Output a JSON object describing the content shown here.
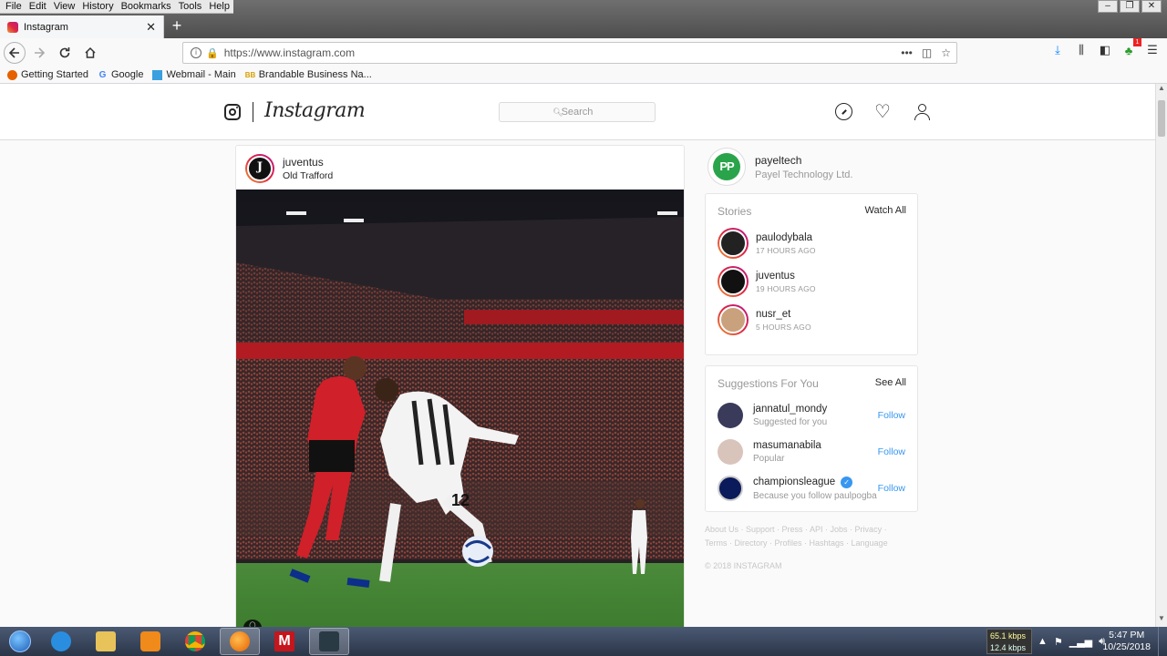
{
  "browser": {
    "menu": [
      "File",
      "Edit",
      "View",
      "History",
      "Bookmarks",
      "Tools",
      "Help"
    ],
    "tab_title": "Instagram",
    "tab_close": "✕",
    "new_tab": "+",
    "url": "https://www.instagram.com",
    "bookmarks": [
      "Getting Started",
      "Google",
      "Webmail - Main",
      "Brandable Business Na..."
    ],
    "window_controls": [
      "–",
      "❐",
      "✕"
    ]
  },
  "instagram": {
    "wordmark": "Instagram",
    "search_placeholder": "Search",
    "post": {
      "username": "juventus",
      "location": "Old Trafford",
      "player_number": "12"
    },
    "profile": {
      "username": "payeltech",
      "full_name": "Payel Technology Ltd.",
      "avatar_initials": "PP"
    },
    "stories": {
      "title": "Stories",
      "action": "Watch All",
      "items": [
        {
          "username": "paulodybala",
          "time": "17 HOURS AGO"
        },
        {
          "username": "juventus",
          "time": "19 HOURS AGO"
        },
        {
          "username": "nusr_et",
          "time": "5 HOURS AGO"
        }
      ]
    },
    "suggestions": {
      "title": "Suggestions For You",
      "action": "See All",
      "items": [
        {
          "username": "jannatul_mondy",
          "subtitle": "Suggested for you",
          "action": "Follow"
        },
        {
          "username": "masumanabila",
          "subtitle": "Popular",
          "action": "Follow"
        },
        {
          "username": "championsleague",
          "subtitle": "Because you follow paulpogba",
          "action": "Follow"
        }
      ]
    },
    "footer": {
      "links_line1": "About Us · Support · Press · API · Jobs · Privacy ·",
      "links_line2": "Terms · Directory · Profiles · Hashtags · Language",
      "copyright": "© 2018 INSTAGRAM"
    }
  },
  "taskbar": {
    "net_down": "65.1 kbps",
    "net_up": "12.4 kbps",
    "time": "5:47 PM",
    "date": "10/25/2018"
  },
  "colors": {
    "link_blue": "#3897f0",
    "story_ring_start": "#f09433",
    "story_ring_end": "#bc1888",
    "jersey_red": "#d0202a"
  }
}
